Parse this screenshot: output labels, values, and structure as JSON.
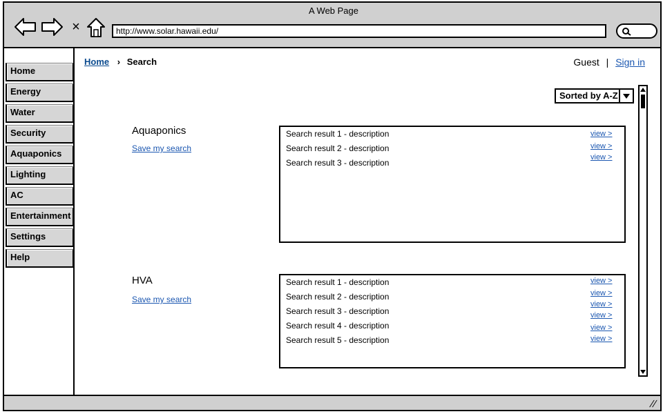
{
  "window": {
    "title": "A Web Page"
  },
  "address_bar": {
    "url": "http://www.solar.hawaii.edu/"
  },
  "sidebar": {
    "items": [
      {
        "label": "Home"
      },
      {
        "label": "Energy"
      },
      {
        "label": "Water"
      },
      {
        "label": "Security"
      },
      {
        "label": "Aquaponics"
      },
      {
        "label": "Lighting"
      },
      {
        "label": "AC"
      },
      {
        "label": "Entertainment"
      },
      {
        "label": "Settings"
      },
      {
        "label": "Help"
      }
    ]
  },
  "breadcrumb": {
    "home": "Home",
    "current": "Search"
  },
  "user": {
    "name": "Guest",
    "separator": "|",
    "sign_in": "Sign in"
  },
  "sort": {
    "selected": "Sorted by A-Z"
  },
  "sections": [
    {
      "title": "Aquaponics",
      "save_label": "Save my search",
      "results": [
        "Search result 1 - description",
        "Search result 2 - description",
        "Search result 3 - description"
      ],
      "view_labels": [
        "view >",
        "view >",
        "view >"
      ]
    },
    {
      "title": "HVA",
      "save_label": "Save my search",
      "results": [
        "Search result 1 - description",
        "Search result 2 - description",
        "Search result 3 - description",
        "Search result 4 - description",
        "Search result 5 - description"
      ],
      "view_labels": [
        "view >",
        "view >",
        "view >",
        "view >",
        "view >",
        "view >"
      ]
    }
  ],
  "colors": {
    "chrome": "#d0d0d0",
    "link": "#1a56b0",
    "nav_bg": "#d6d6d6"
  }
}
